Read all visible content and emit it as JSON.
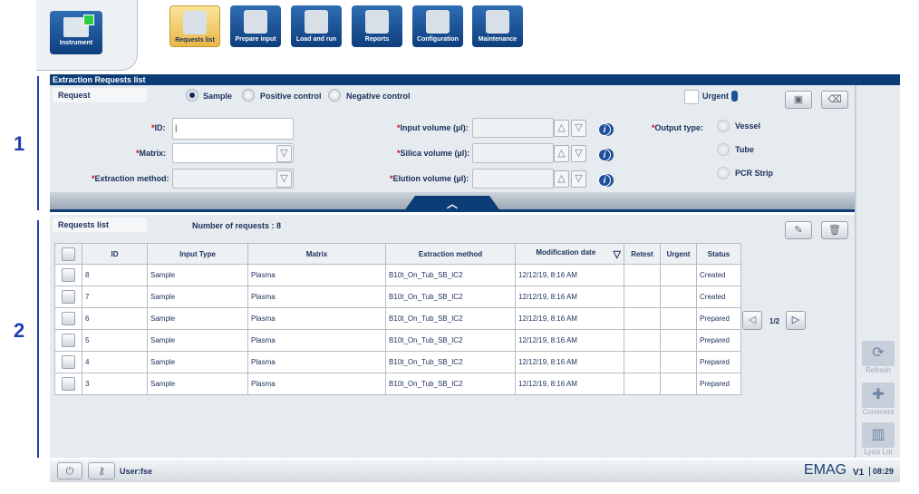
{
  "nav": {
    "instrument": "Instrument",
    "tabs": [
      "Requests list",
      "Prepare input",
      "Load and run",
      "Reports",
      "Configuration",
      "Maintenance"
    ]
  },
  "title": "Extraction Requests list",
  "request": {
    "section": "Request",
    "types": [
      "Sample",
      "Positive control",
      "Negative control"
    ],
    "selected_type": "Sample",
    "urgent": "Urgent",
    "id_label": "ID:",
    "id_value": "",
    "matrix_label": "Matrix:",
    "method_label": "Extraction method:",
    "input_volume": "Input volume (µl):",
    "silica_volume": "Silica volume (µl):",
    "elution_volume": "Elution volume (µl):",
    "output_type": "Output type:",
    "outputs": [
      "Vessel",
      "Tube",
      "PCR Strip"
    ],
    "required_mark": "*"
  },
  "list": {
    "section": "Requests list",
    "count_label": "Number of requests : 8",
    "columns": [
      "ID",
      "Input Type",
      "Matrix",
      "Extraction method",
      "Modification date",
      "Retest",
      "Urgent",
      "Status"
    ],
    "rows": [
      {
        "id": "8",
        "type": "Sample",
        "matrix": "Plasma",
        "method": "B10t_On_Tub_SB_IC2",
        "date": "12/12/19, 8:16 AM",
        "retest": "",
        "urgent": "",
        "status": "Created"
      },
      {
        "id": "7",
        "type": "Sample",
        "matrix": "Plasma",
        "method": "B10t_On_Tub_SB_IC2",
        "date": "12/12/19, 8:16 AM",
        "retest": "",
        "urgent": "",
        "status": "Created"
      },
      {
        "id": "6",
        "type": "Sample",
        "matrix": "Plasma",
        "method": "B10t_On_Tub_SB_IC2",
        "date": "12/12/19, 8:16 AM",
        "retest": "",
        "urgent": "",
        "status": "Prepared"
      },
      {
        "id": "5",
        "type": "Sample",
        "matrix": "Plasma",
        "method": "B10t_On_Tub_SB_IC2",
        "date": "12/12/19, 8:16 AM",
        "retest": "",
        "urgent": "",
        "status": "Prepared"
      },
      {
        "id": "4",
        "type": "Sample",
        "matrix": "Plasma",
        "method": "B10t_On_Tub_SB_IC2",
        "date": "12/12/19, 8:16 AM",
        "retest": "",
        "urgent": "",
        "status": "Prepared"
      },
      {
        "id": "3",
        "type": "Sample",
        "matrix": "Plasma",
        "method": "B10t_On_Tub_SB_IC2",
        "date": "12/12/19, 8:16 AM",
        "retest": "",
        "urgent": "",
        "status": "Prepared"
      }
    ],
    "page": "1/2"
  },
  "side": {
    "refresh": "Refresh",
    "comment": "Comment",
    "lysis": "Lysis Lot"
  },
  "status": {
    "user": "User:fse",
    "brand": "EMAG",
    "version": "V1",
    "time": "08:29"
  },
  "annotations": [
    "1",
    "2"
  ]
}
